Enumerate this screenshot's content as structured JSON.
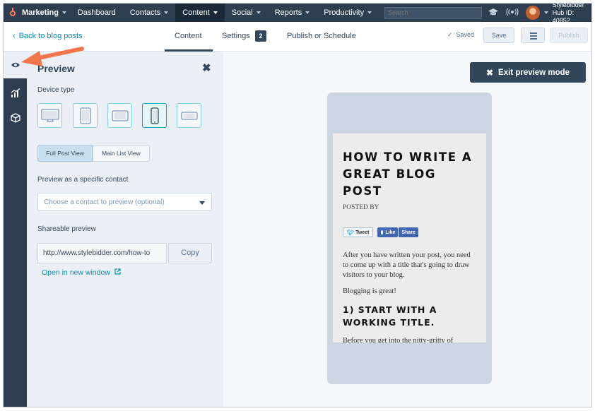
{
  "topnav": {
    "brand": "Marketing",
    "items": [
      {
        "label": "Dashboard",
        "has_caret": false
      },
      {
        "label": "Contacts",
        "has_caret": true
      },
      {
        "label": "Content",
        "has_caret": true
      },
      {
        "label": "Social",
        "has_caret": true
      },
      {
        "label": "Reports",
        "has_caret": true
      },
      {
        "label": "Productivity",
        "has_caret": true
      }
    ],
    "search_placeholder": "Search",
    "account_name": "Stylebidder",
    "hub_id": "Hub ID: 40852"
  },
  "editor_header": {
    "back_link": "Back to blog posts",
    "tabs": {
      "content": "Content",
      "settings": "Settings",
      "settings_badge": "2",
      "publish": "Publish or Schedule"
    },
    "saved": "Saved",
    "save_button": "Save",
    "publish_button": "Publish"
  },
  "preview_panel": {
    "title": "Preview",
    "device_type_label": "Device type",
    "devices": [
      "desktop",
      "tablet-portrait",
      "tablet-landscape",
      "mobile-portrait",
      "mobile-landscape"
    ],
    "selected_device": "mobile-portrait",
    "view_toggle": {
      "full": "Full Post View",
      "list": "Main List View",
      "selected": "Full Post View"
    },
    "contact_label": "Preview as a specific contact",
    "contact_placeholder": "Choose a contact to preview (optional)",
    "shareable_label": "Shareable preview",
    "shareable_url": "http://www.stylebidder.com/how-to",
    "copy_button": "Copy",
    "open_link": "Open in new window"
  },
  "canvas": {
    "exit_button": "Exit preview mode",
    "post": {
      "title": "HOW TO WRITE A GREAT BLOG POST",
      "posted_by": "POSTED BY",
      "tweet_label": "Tweet",
      "like_label": "Like",
      "share_label": "Share",
      "paragraph1": "After you have written your post, you need to come up with a title that's going to draw visitors to your blog.",
      "paragraph2": "Blogging is great!",
      "heading2": "1) START WITH A WORKING TITLE.",
      "paragraph3": "Before you get into the nitty-gritty of coming up with a perfect title, start with a rough draft: your working title. What is"
    }
  },
  "colors": {
    "nav_bg": "#2d3e50",
    "accent_link": "#0091ae",
    "panel_bg": "#eaf0f6",
    "hubspot_orange": "#ff7a59",
    "annotation_arrow": "#f2764b"
  }
}
